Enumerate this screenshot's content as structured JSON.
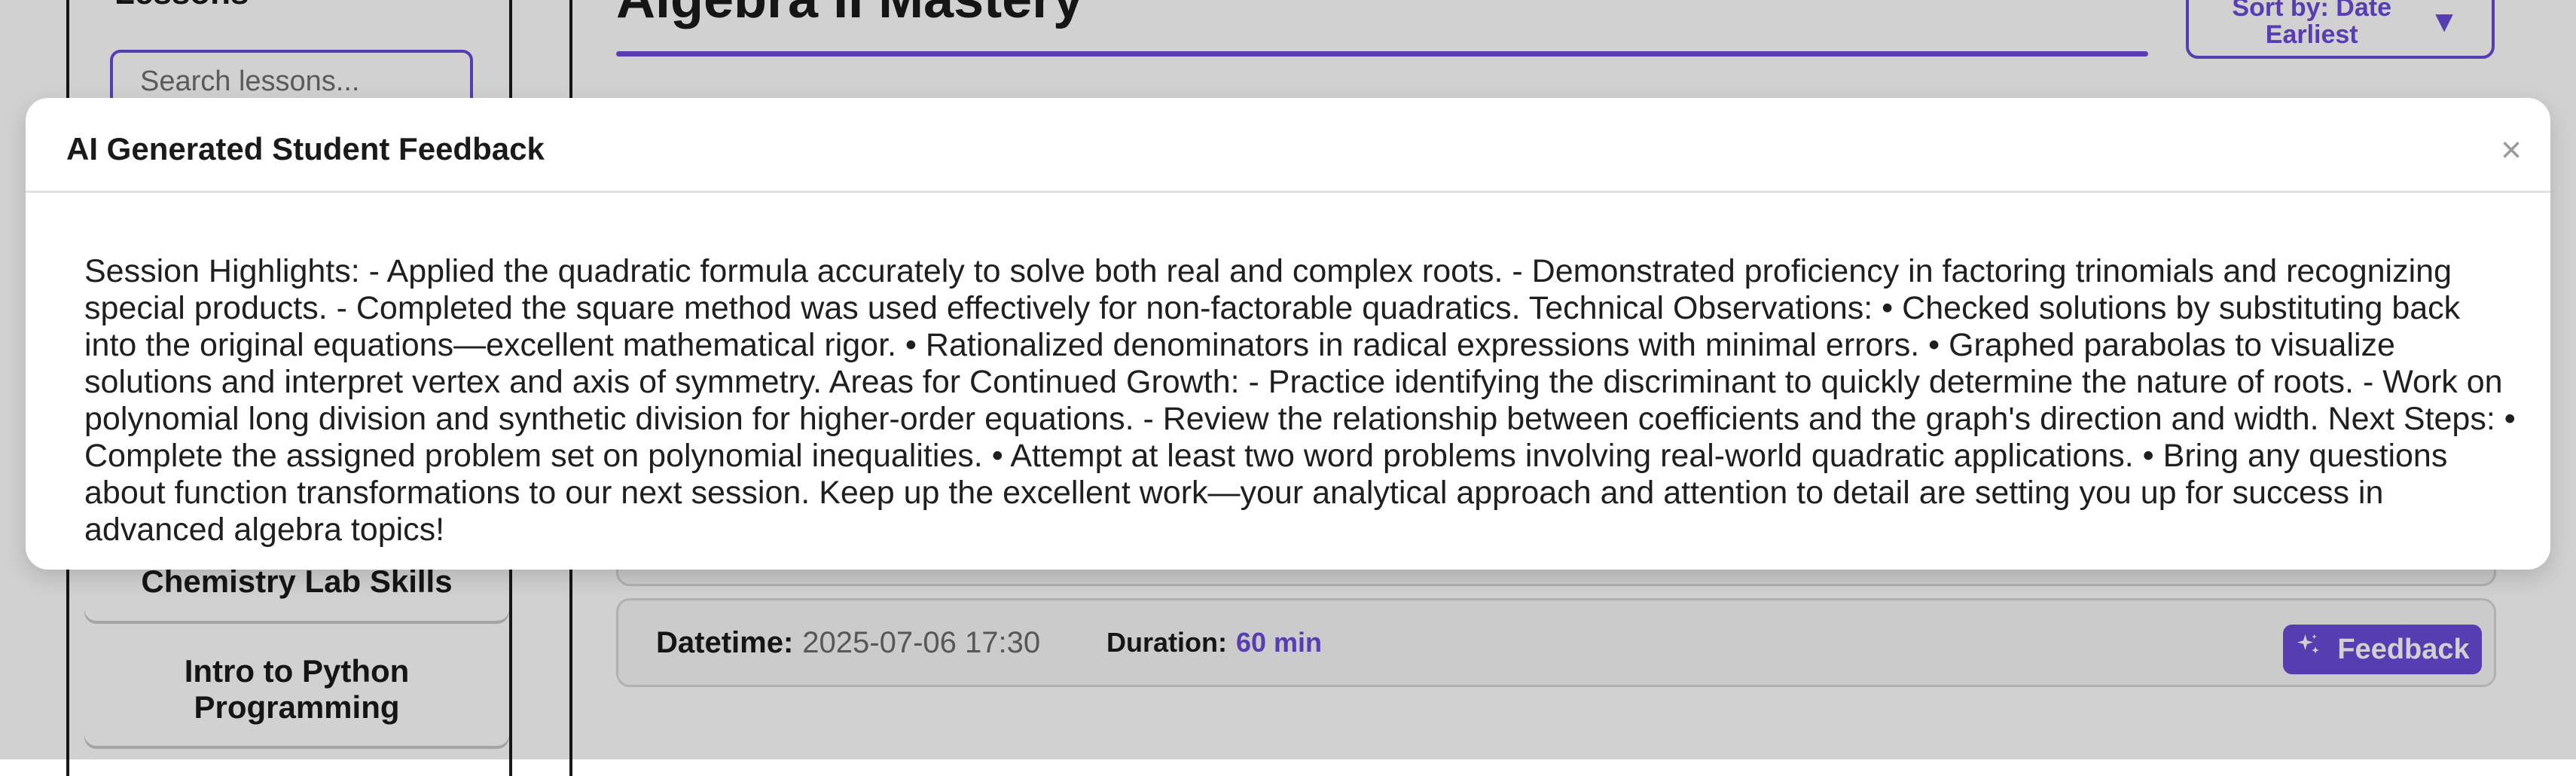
{
  "sidebar": {
    "title": "Lessons",
    "search_placeholder": "Search lessons...",
    "items": [
      {
        "label": "Chemistry Lab Skills"
      },
      {
        "label": "Intro to Python Programming"
      }
    ]
  },
  "main": {
    "title": "Algebra II Mastery",
    "sort": {
      "label": "Sort by: Date Earliest",
      "icon": "caret-down-icon"
    },
    "session": {
      "datetime_label": "Datetime:",
      "datetime_value": "2025-07-06 17:30",
      "duration_label": "Duration:",
      "duration_value": "60 min",
      "feedback_label": "Feedback",
      "feedback_icon": "sparkles-icon"
    }
  },
  "modal": {
    "title": "AI Generated Student Feedback",
    "close_label": "×",
    "body": "Session Highlights: - Applied the quadratic formula accurately to solve both real and complex roots. - Demonstrated proficiency in factoring trinomials and recognizing special products. - Completed the square method was used effectively for non-factorable quadratics. Technical Observations: • Checked solutions by substituting back into the original equations—excellent mathematical rigor. • Rationalized denominators in radical expressions with minimal errors. • Graphed parabolas to visualize solutions and interpret vertex and axis of symmetry. Areas for Continued Growth: - Practice identifying the discriminant to quickly determine the nature of roots. - Work on polynomial long division and synthetic division for higher-order equations. - Review the relationship between coefficients and the graph's direction and width. Next Steps: • Complete the assigned problem set on polynomial inequalities. • Attempt at least two word problems involving real-world quadratic applications. • Bring any questions about function transformations to our next session. Keep up the excellent work—your analytical approach and attention to detail are setting you up for success in advanced algebra topics!"
  },
  "colors": {
    "accent": "#6a4bd8",
    "overlay": "#000000"
  }
}
